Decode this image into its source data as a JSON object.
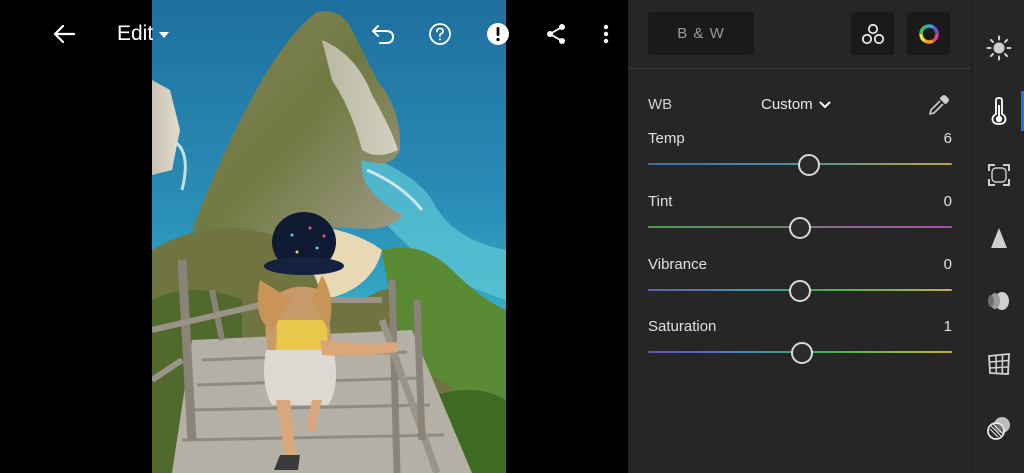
{
  "topbar": {
    "mode_label": "Edit"
  },
  "panel": {
    "bw_label": "B & W",
    "wb": {
      "label": "WB",
      "value": "Custom"
    },
    "sliders": [
      {
        "name": "Temp",
        "value": "6",
        "position": 0.53
      },
      {
        "name": "Tint",
        "value": "0",
        "position": 0.5
      },
      {
        "name": "Vibrance",
        "value": "0",
        "position": 0.5
      },
      {
        "name": "Saturation",
        "value": "1",
        "position": 0.505
      }
    ]
  },
  "rail": {
    "items": [
      {
        "icon": "light-icon"
      },
      {
        "icon": "color-temperature-icon",
        "active": true
      },
      {
        "icon": "effects-icon"
      },
      {
        "icon": "detail-icon"
      },
      {
        "icon": "optics-icon"
      },
      {
        "icon": "geometry-icon"
      },
      {
        "icon": "presets-icon"
      }
    ]
  },
  "colors": {
    "panel_bg": "#262626",
    "accent": "#1a73e8"
  }
}
